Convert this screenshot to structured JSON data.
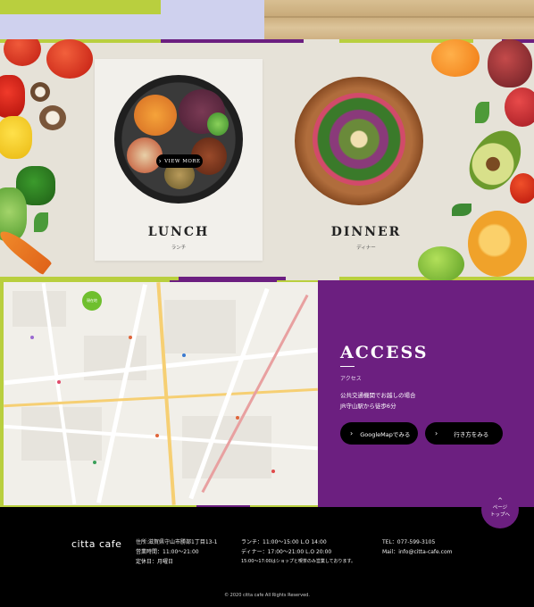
{
  "menu": {
    "lunch": {
      "title": "LUNCH",
      "subtitle": "ランチ",
      "view_more": "VIEW MORE"
    },
    "dinner": {
      "title": "DINNER",
      "subtitle": "ディナー"
    }
  },
  "access": {
    "title": "ACCESS",
    "subtitle": "アクセス",
    "line1": "公共交通機関でお越しの場合",
    "line2": "JR守山駅から徒歩6分",
    "google_map_button": "GoogleMapでみる",
    "route_button": "行き方をみる"
  },
  "page_top": {
    "line1": "ページ",
    "line2": "トップへ"
  },
  "map": {
    "current_location": "現在地"
  },
  "footer": {
    "logo": "citta cafe",
    "address": "住所:滋賀県守山市勝部1丁目13-1",
    "hours": "営業時間：11:00～21:00",
    "closed": "定休日：月曜日",
    "lunch_hours": "ランチ：11:00～15:00 L.O 14:00",
    "dinner_hours": "ディナー：17:00～21:00 L.O 20:00",
    "note": "15:00～17:00はショップと喫茶のみ営業しております。",
    "tel": "TEL：077-599-3105",
    "mail": "Mail：info@citta-cafe.com",
    "copyright": "© 2020 citta cafe All Rights Reserved."
  },
  "colors": {
    "purple": "#6c1f80",
    "green_accent": "#b9cf3e",
    "footer_bg": "#000000"
  }
}
